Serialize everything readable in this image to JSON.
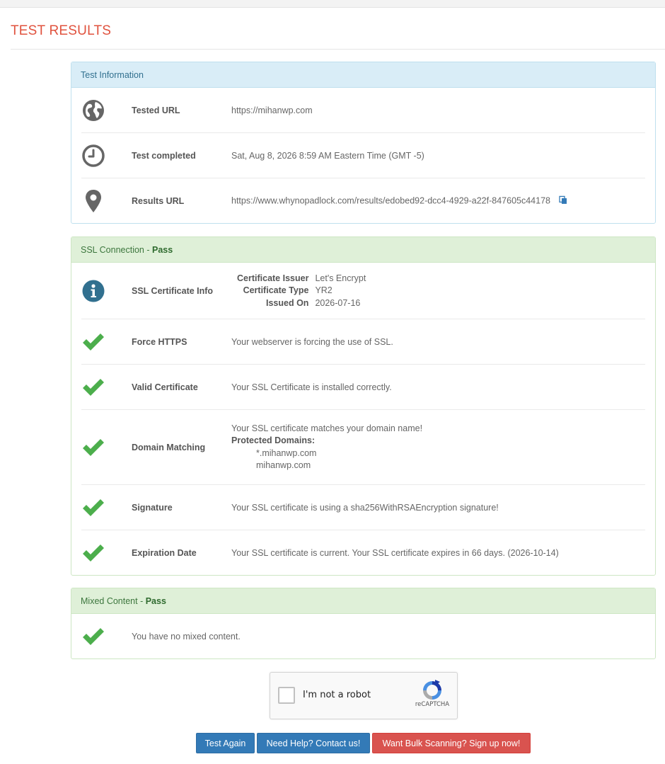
{
  "page": {
    "title": "TEST RESULTS"
  },
  "test_info": {
    "heading": "Test Information",
    "rows": [
      {
        "icon": "globe-icon",
        "label": "Tested URL",
        "value": "https://mihanwp.com"
      },
      {
        "icon": "clock-icon",
        "label": "Test completed",
        "value": "Sat, Aug 8, 2026 8:59 AM Eastern Time (GMT -5)"
      },
      {
        "icon": "map-pin-icon",
        "label": "Results URL",
        "value": "https://www.whynopadlock.com/results/edobed92-dcc4-4929-a22f-847605c44178",
        "action_icon": "copy-icon"
      }
    ]
  },
  "ssl": {
    "heading": "SSL Connection",
    "status_sep": " - ",
    "status": "Pass",
    "cert_info": {
      "icon": "info-icon",
      "label": "SSL Certificate Info",
      "fields": [
        {
          "key": "Certificate Issuer",
          "value": "Let's Encrypt"
        },
        {
          "key": "Certificate Type",
          "value": "YR2"
        },
        {
          "key": "Issued On",
          "value": "2026-07-16"
        }
      ]
    },
    "checks": [
      {
        "icon": "check-icon",
        "label": "Force HTTPS",
        "value": "Your webserver is forcing the use of SSL."
      },
      {
        "icon": "check-icon",
        "label": "Valid Certificate",
        "value": "Your SSL Certificate is installed correctly."
      }
    ],
    "domain_matching": {
      "icon": "check-icon",
      "label": "Domain Matching",
      "line1": "Your SSL certificate matches your domain name!",
      "protected_label": "Protected Domains:",
      "domains": [
        "*.mihanwp.com",
        "mihanwp.com"
      ]
    },
    "checks2": [
      {
        "icon": "check-icon",
        "label": "Signature",
        "value": "Your SSL certificate is using a sha256WithRSAEncryption signature!"
      },
      {
        "icon": "check-icon",
        "label": "Expiration Date",
        "value": "Your SSL certificate is current. Your SSL certificate expires in 66 days. (2026-10-14)"
      }
    ]
  },
  "mixed": {
    "heading": "Mixed Content",
    "status_sep": " - ",
    "status": "Pass",
    "icon": "check-icon",
    "value": "You have no mixed content."
  },
  "captcha": {
    "label": "I'm not a robot",
    "brand": "reCAPTCHA"
  },
  "buttons": {
    "test_again": "Test Again",
    "contact": "Need Help? Contact us!",
    "bulk": "Want Bulk Scanning? Sign up now!"
  },
  "colors": {
    "title": "#e0523e",
    "check": "#4cae4c",
    "info_icon": "#31708f",
    "icon_gray": "#666666",
    "btn_blue": "#337ab7",
    "btn_red": "#d9534f"
  }
}
